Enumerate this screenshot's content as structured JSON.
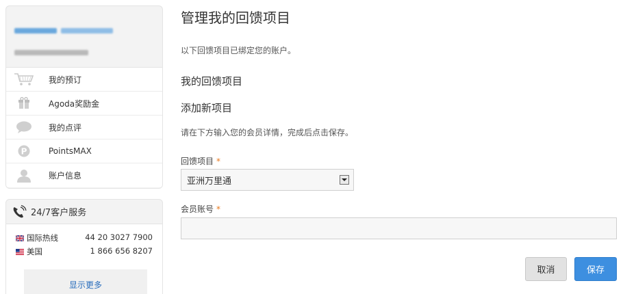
{
  "sidebar": {
    "menu": [
      {
        "label": "我的预订",
        "icon": "cart-icon"
      },
      {
        "label": "Agoda奖励金",
        "icon": "gift-icon"
      },
      {
        "label": "我的点评",
        "icon": "chat-bubble-icon"
      },
      {
        "label": "PointsMAX",
        "icon": "points-icon"
      },
      {
        "label": "账户信息",
        "icon": "user-icon"
      }
    ],
    "support": {
      "title": "24/7客户服务",
      "hotlines": [
        {
          "region": "国际热线",
          "number": "44 20 3027 7900",
          "flag": "uk-flag-icon"
        },
        {
          "region": "美国",
          "number": "1 866 656 8207",
          "flag": "us-flag-icon"
        }
      ],
      "show_more": "显示更多"
    }
  },
  "main": {
    "title": "管理我的回馈项目",
    "intro": "以下回馈项目已绑定您的账户。",
    "my_programs_heading": "我的回馈项目",
    "add_new_heading": "添加新项目",
    "hint": "请在下方输入您的会员详情，完成后点击保存。",
    "program_label": "回馈项目",
    "program_value": "亚洲万里通",
    "member_label": "会员账号",
    "member_value": "",
    "required_mark": "*",
    "cancel_label": "取消",
    "save_label": "保存"
  },
  "colors": {
    "accent": "#3d8fe0",
    "required": "#e8791e",
    "link": "#2a6ebd"
  }
}
